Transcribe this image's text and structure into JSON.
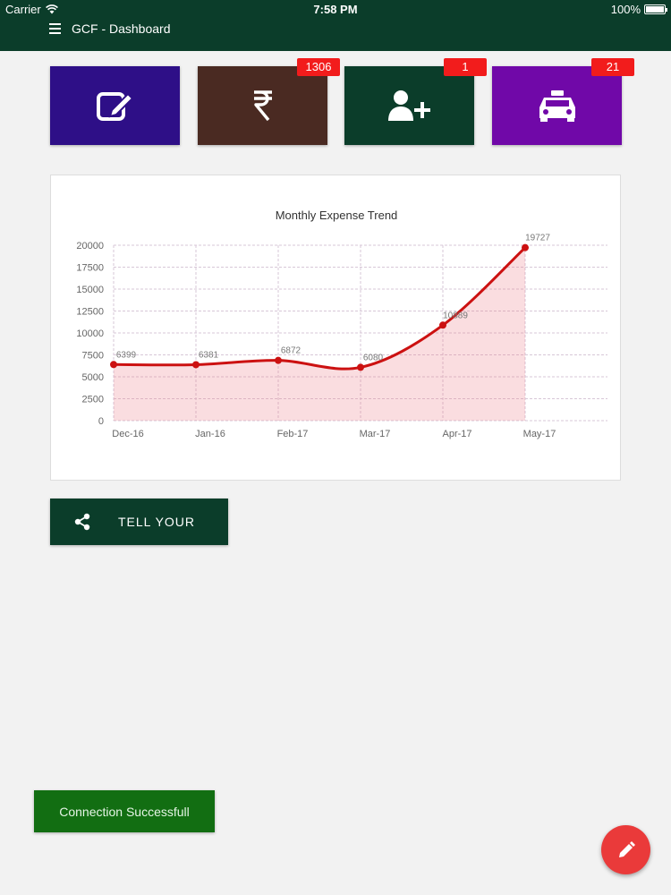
{
  "status_bar": {
    "carrier": "Carrier",
    "time": "7:58 PM",
    "battery": "100%",
    "battery_level": 1.0
  },
  "header": {
    "title": "GCF - Dashboard",
    "menu_icon": "hamburger-menu-icon",
    "background": "#0b3d2a"
  },
  "tiles": [
    {
      "name": "edit",
      "icon": "edit-icon",
      "color": "#2e0f87",
      "badge": ""
    },
    {
      "name": "expense",
      "icon": "rupee-icon",
      "color": "#4a2a22",
      "badge": "1306"
    },
    {
      "name": "add-user",
      "icon": "add-user-icon",
      "color": "#0b3d2a",
      "badge": "1"
    },
    {
      "name": "taxi",
      "icon": "taxi-icon",
      "color": "#7008a8",
      "badge": "21"
    }
  ],
  "chart_data": {
    "type": "area",
    "title": "Monthly Expense Trend",
    "categories": [
      "Dec-16",
      "Jan-16",
      "Feb-17",
      "Mar-17",
      "Apr-17",
      "May-17"
    ],
    "series": [
      {
        "values": [
          6399,
          6381,
          6872,
          6080,
          10889,
          19727
        ],
        "color": "#cc1111"
      }
    ],
    "data_labels": [
      "6399",
      "6381",
      "6872",
      "6080",
      "10889",
      "19727"
    ],
    "yticks": [
      "0",
      "2500",
      "5000",
      "7500",
      "10000",
      "12500",
      "15000",
      "17500",
      "20000"
    ],
    "ylim": [
      0,
      20000
    ],
    "grid": true,
    "legend": "none"
  },
  "share_button": {
    "label": "TELL YOUR",
    "icon": "share-icon"
  },
  "toast": {
    "text": "Connection Successfull",
    "color": "#126e12"
  },
  "fab": {
    "icon": "pencil-icon",
    "color": "#ea3a3a"
  }
}
